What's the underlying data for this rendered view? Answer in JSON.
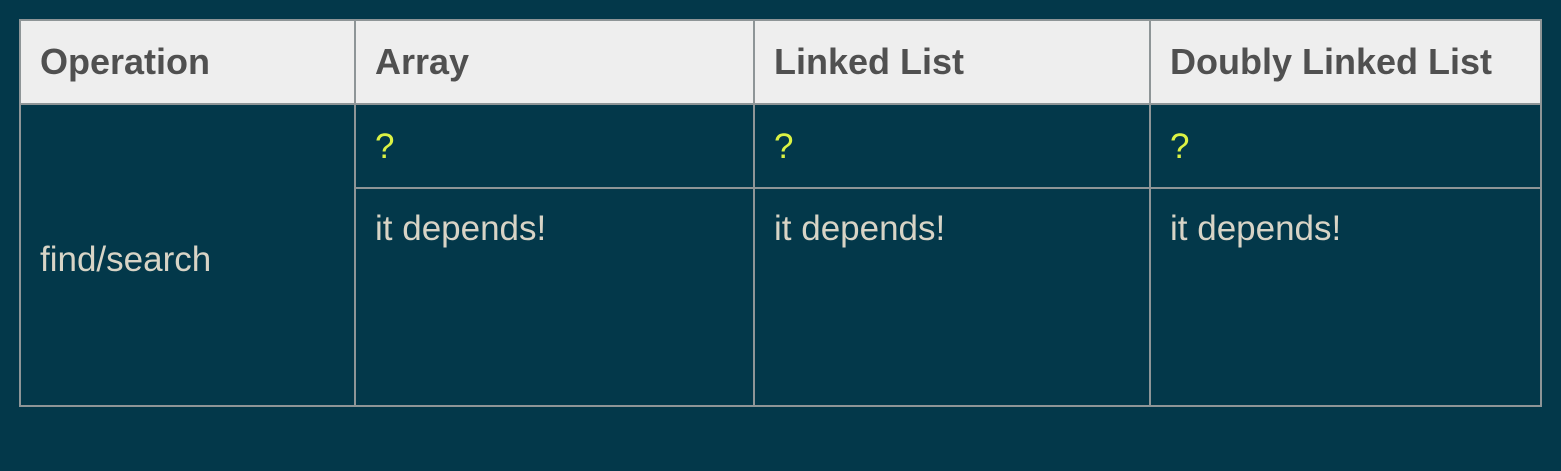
{
  "table": {
    "headers": [
      "Operation",
      "Array",
      "Linked List",
      "Doubly Linked List"
    ],
    "operation": "find/search",
    "question_row": [
      "?",
      "?",
      "?"
    ],
    "answer_row": [
      "it depends!",
      "it depends!",
      "it depends!"
    ]
  },
  "colors": {
    "background": "#03384a",
    "header_background": "#eeeeee",
    "header_text": "#505050",
    "cell_text": "#d8d4c6",
    "question_text": "#dbf244",
    "border": "#8e9597"
  }
}
